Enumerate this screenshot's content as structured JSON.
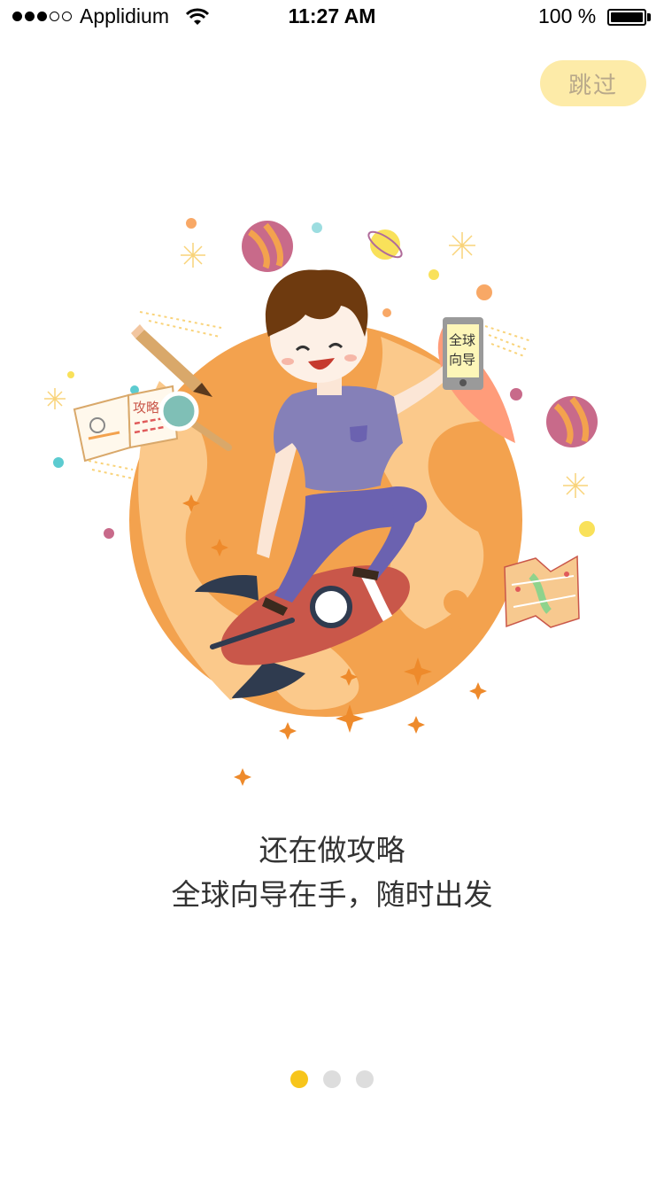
{
  "status_bar": {
    "carrier": "Applidium",
    "time": "11:27 AM",
    "battery": "100 %",
    "battery_level": 1.0,
    "signal_bars_filled": 3,
    "signal_bars_total": 5
  },
  "skip_label": "跳过",
  "illustration": {
    "phone_text_line1": "全球",
    "phone_text_line2": "向导",
    "book_text": "攻略"
  },
  "caption": {
    "line1": "还在做攻略",
    "line2": "全球向导在手，随时出发"
  },
  "pager": {
    "total": 3,
    "active_index": 0
  },
  "colors": {
    "accent": "#f7c51b",
    "skip_bg": "#fdeba8",
    "planet": "#f3a24e",
    "rocket": "#c9574a",
    "shirt": "#8580b8"
  }
}
